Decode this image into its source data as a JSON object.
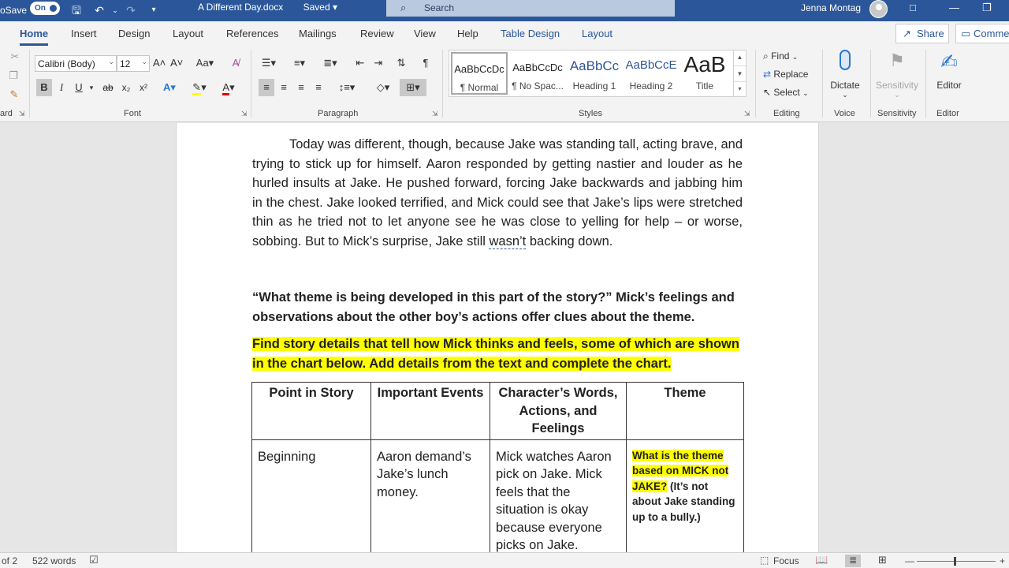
{
  "titlebar": {
    "autosave_label": "oSave",
    "autosave_state": "On",
    "doc_name": "A Different Day.docx",
    "save_status": "Saved",
    "search_placeholder": "Search",
    "user_name": "Jenna Montag"
  },
  "tabs": [
    "Home",
    "Insert",
    "Design",
    "Layout",
    "References",
    "Mailings",
    "Review",
    "View",
    "Help",
    "Table Design",
    "Layout"
  ],
  "actions": {
    "share": "Share",
    "comments": "Comme"
  },
  "ribbon": {
    "clipboard_label": "ard",
    "font": {
      "name": "Calibri (Body)",
      "size": "12",
      "group_label": "Font"
    },
    "paragraph_label": "Paragraph",
    "styles": {
      "group_label": "Styles",
      "items": [
        {
          "preview": "AaBbCcDc",
          "name": "¶ Normal"
        },
        {
          "preview": "AaBbCcDc",
          "name": "¶ No Spac..."
        },
        {
          "preview": "AaBbCc",
          "name": "Heading 1"
        },
        {
          "preview": "AaBbCcE",
          "name": "Heading 2"
        },
        {
          "preview": "AaB",
          "name": "Title"
        }
      ]
    },
    "editing": {
      "group_label": "Editing",
      "find": "Find",
      "replace": "Replace",
      "select": "Select"
    },
    "voice": {
      "group_label": "Voice",
      "dictate": "Dictate"
    },
    "sensitivity": {
      "group_label": "Sensitivity",
      "button": "Sensitivity"
    },
    "editor": {
      "group_label": "Editor",
      "button": "Editor"
    }
  },
  "document": {
    "p1_before": "Today was different, though, because Jake was standing tall, acting brave, and trying to stick up for himself.  Aaron responded by getting nastier and louder as he hurled insults at Jake.  He pushed forward, forcing Jake backwards and jabbing him in the chest.  Jake looked terrified, and Mick could see that Jake’s lips were stretched thin as he tried not to let anyone see he was close to yelling for help – or worse, sobbing.  But to Mick’s surprise, Jake still ",
    "p1_squiggle": "wasn’t",
    "p1_after": " backing down.",
    "question": "“What theme is being developed in this part of the story?” Mick’s feelings and observations about the other boy’s actions offer clues about the theme.",
    "instruction": "Find story details that tell how Mick thinks and feels, some of which are shown in the chart below.  Add details from the text and complete the chart.",
    "table": {
      "headers": [
        "Point in Story",
        "Important Events",
        "Character’s Words, Actions, and Feelings",
        "Theme"
      ],
      "row": {
        "point": "Beginning",
        "events": "Aaron demand’s Jake’s lunch money.",
        "character": "Mick watches Aaron pick on Jake.  Mick feels that the situation is okay because everyone picks on Jake.",
        "theme_highlight": "What is the theme based on MICK not JAKE?",
        "theme_rest": " (It’s not about Jake standing up to a bully.)"
      }
    }
  },
  "statusbar": {
    "page": "of 2",
    "words": "522 words",
    "focus": "Focus"
  },
  "colors": {
    "accent": "#2b579a",
    "highlight": "#ffff00"
  }
}
